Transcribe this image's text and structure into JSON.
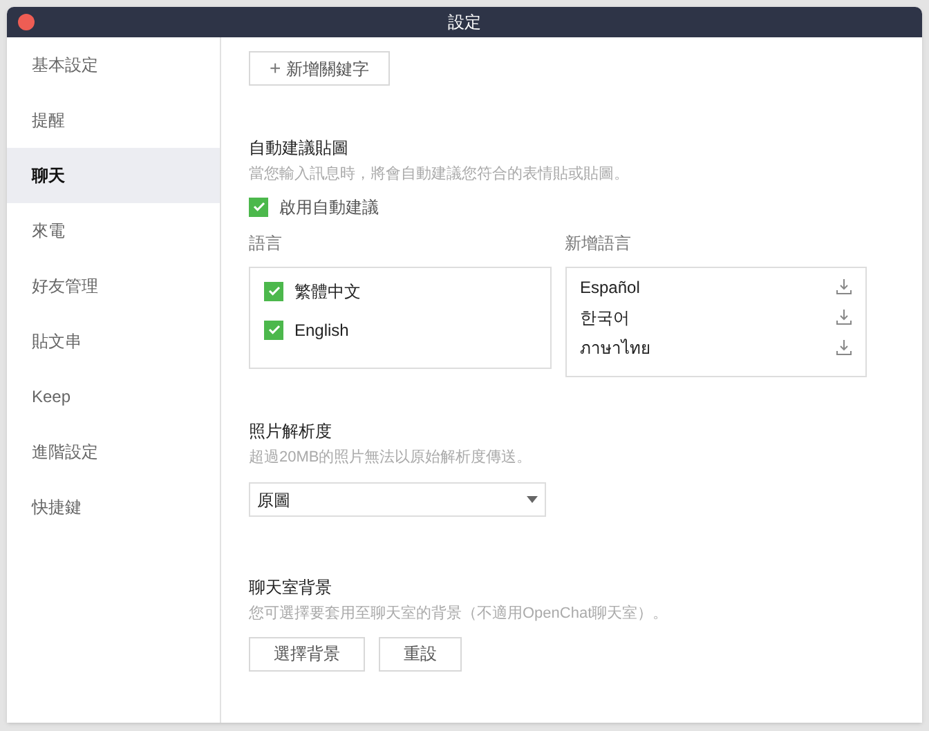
{
  "window": {
    "title": "設定"
  },
  "sidebar": {
    "items": [
      {
        "label": "基本設定",
        "selected": false
      },
      {
        "label": "提醒",
        "selected": false
      },
      {
        "label": "聊天",
        "selected": true
      },
      {
        "label": "來電",
        "selected": false
      },
      {
        "label": "好友管理",
        "selected": false
      },
      {
        "label": "貼文串",
        "selected": false
      },
      {
        "label": "Keep",
        "selected": false
      },
      {
        "label": "進階設定",
        "selected": false
      },
      {
        "label": "快捷鍵",
        "selected": false
      }
    ]
  },
  "add_keyword_button": {
    "icon": "+",
    "label": "新增關鍵字"
  },
  "sticker_suggestions": {
    "title": "自動建議貼圖",
    "description": "當您輸入訊息時，將會自動建議您符合的表情貼或貼圖。",
    "enable": {
      "label": "啟用自動建議",
      "checked": true
    },
    "languages": {
      "title": "語言",
      "items": [
        {
          "label": "繁體中文",
          "checked": true
        },
        {
          "label": "English",
          "checked": true
        }
      ]
    },
    "add_languages": {
      "title": "新增語言",
      "items": [
        {
          "label": "Español"
        },
        {
          "label": "한국어"
        },
        {
          "label": "ภาษาไทย"
        }
      ]
    }
  },
  "photo_resolution": {
    "title": "照片解析度",
    "description": "超過20MB的照片無法以原始解析度傳送。",
    "value": "原圖"
  },
  "chat_background": {
    "title": "聊天室背景",
    "description": "您可選擇要套用至聊天室的背景（不適用OpenChat聊天室）。",
    "buttons": [
      "選擇背景",
      "重設"
    ]
  }
}
